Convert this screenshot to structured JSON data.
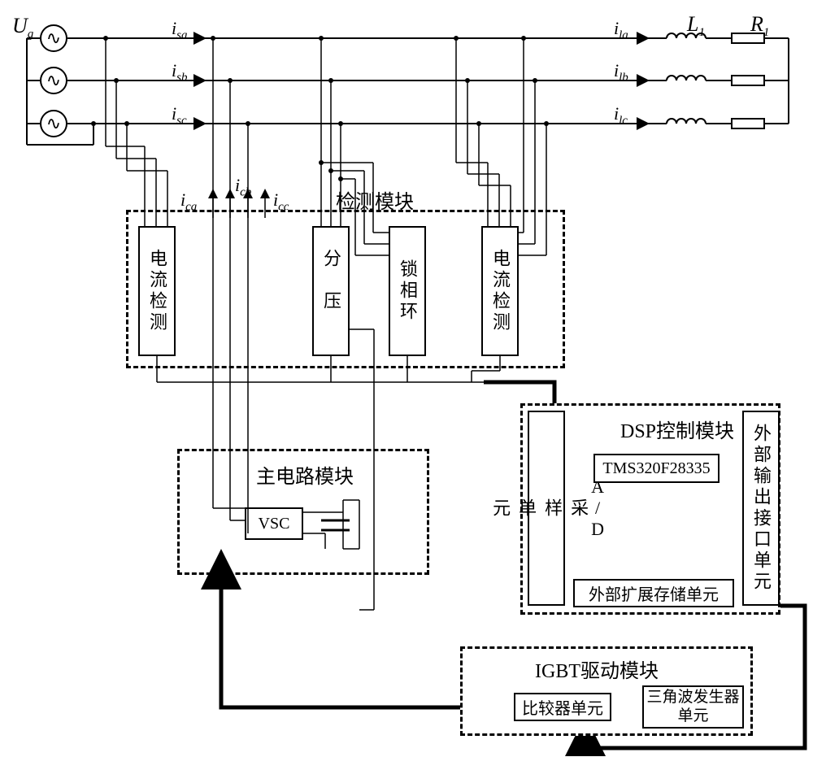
{
  "labels": {
    "Ug": "U",
    "Ug_sub": "g",
    "isa": "i",
    "isa_sub": "sa",
    "isb": "i",
    "isb_sub": "sb",
    "isc": "i",
    "isc_sub": "sc",
    "ila": "i",
    "ila_sub": "la",
    "ilb": "i",
    "ilb_sub": "lb",
    "ilc": "i",
    "ilc_sub": "lc",
    "ica": "i",
    "ica_sub": "ca",
    "icb": "i",
    "icb_sub": "cb",
    "icc": "i",
    "icc_sub": "cc",
    "L1": "L",
    "L1_sub": "1",
    "R1": "R",
    "R1_sub": "1"
  },
  "blocks": {
    "detection_module": "检测模块",
    "current_det1": "电流检测",
    "current_det2": "电流检测",
    "divider": "分压",
    "pll": "锁相环",
    "main_circuit": "主电路模块",
    "vsc": "VSC",
    "dsp_module": "DSP控制模块",
    "dsp_chip": "TMS320F28335",
    "ad_unit": "A/D采样单元",
    "ext_storage": "外部扩展存储单元",
    "ext_output": "外部输出接口单元",
    "igbt_module": "IGBT驱动模块",
    "comparator": "比较器单元",
    "triangle_gen": "三角波发生器单元"
  }
}
